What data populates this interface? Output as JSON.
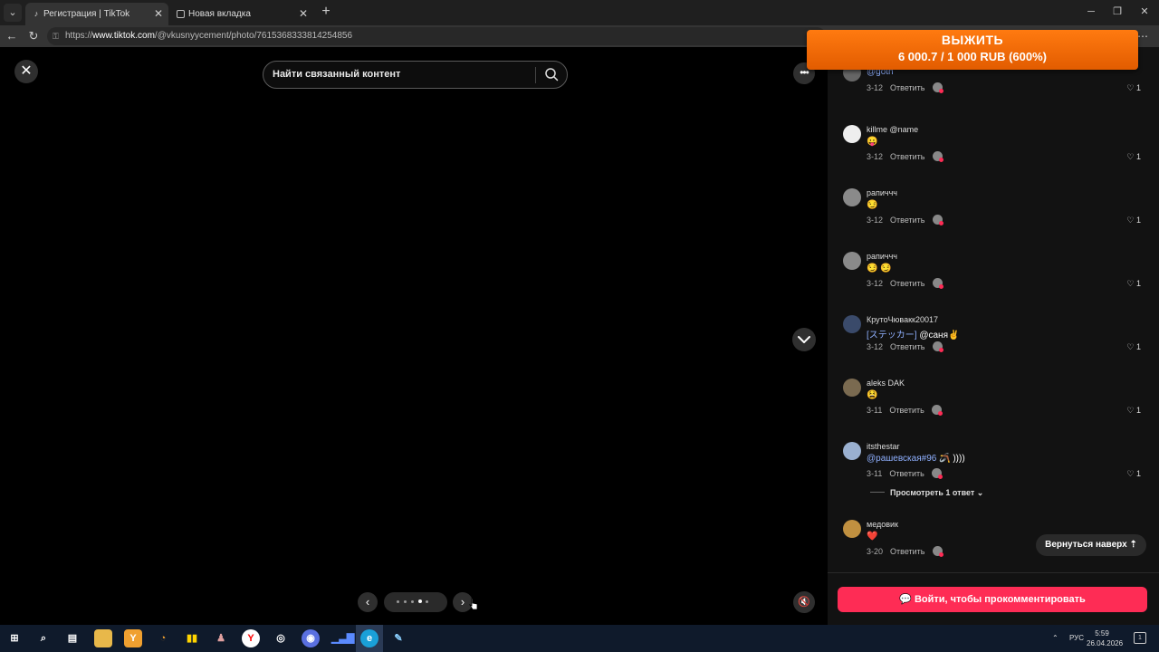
{
  "browser": {
    "tabs": [
      {
        "label": "Регистрация | TikTok",
        "active": true
      },
      {
        "label": "Новая вкладка",
        "active": false
      }
    ],
    "url_prefix": "https://",
    "url_host": "www.tiktok.com",
    "url_path": "/@vkusnyycement/photo/7615368333814254856"
  },
  "promo": {
    "title": "ВЫЖИТЬ",
    "amount": "6 000.7 / 1 000 RUB (600%)"
  },
  "viewer": {
    "search_placeholder": "Найти связанный контент",
    "carousel_dots": 5,
    "carousel_active": 4
  },
  "comments": [
    {
      "name": "",
      "text_mention": "@goth",
      "text": "",
      "date": "3-12",
      "reply": "Ответить",
      "likes": "1",
      "avatar_color": "#666"
    },
    {
      "name": "killme @name",
      "text_mention": "",
      "text": "😛",
      "date": "3-12",
      "reply": "Ответить",
      "likes": "1",
      "avatar_color": "#eeeeee"
    },
    {
      "name": "рапиччч",
      "text_mention": "",
      "text": "😏",
      "date": "3-12",
      "reply": "Ответить",
      "likes": "1",
      "avatar_color": "#8a8a8a"
    },
    {
      "name": "рапиччч",
      "text_mention": "",
      "text": "😏 😏",
      "date": "3-12",
      "reply": "Ответить",
      "likes": "1",
      "avatar_color": "#8a8a8a"
    },
    {
      "name": "КрутоЧювакк20017",
      "text_mention": "[ステッカー]",
      "text": " @саня✌️",
      "date": "3-12",
      "reply": "Ответить",
      "likes": "1",
      "avatar_color": "#3a4a6a"
    },
    {
      "name": "aleks DAK",
      "text_mention": "",
      "text": "😫",
      "date": "3-11",
      "reply": "Ответить",
      "likes": "1",
      "avatar_color": "#7a6a50"
    },
    {
      "name": "itsthestar",
      "text_mention": "@рашевская#96",
      "text": " 🪃 ))))",
      "date": "3-11",
      "reply": "Ответить",
      "likes": "1",
      "avatar_color": "#9ab0d0"
    },
    {
      "name": "медовик",
      "text_mention": "",
      "text": "❤️",
      "date": "3-20",
      "reply": "Ответить",
      "likes": "",
      "avatar_color": "#c09040"
    }
  ],
  "view_replies": "Просмотреть 1 ответ",
  "back_to_top": "Вернуться наверх",
  "login_button": "Войти, чтобы прокомментировать",
  "taskbar": {
    "lang": "РУС",
    "time": "5:59",
    "date": "26.04.2026",
    "notif_count": "1"
  }
}
